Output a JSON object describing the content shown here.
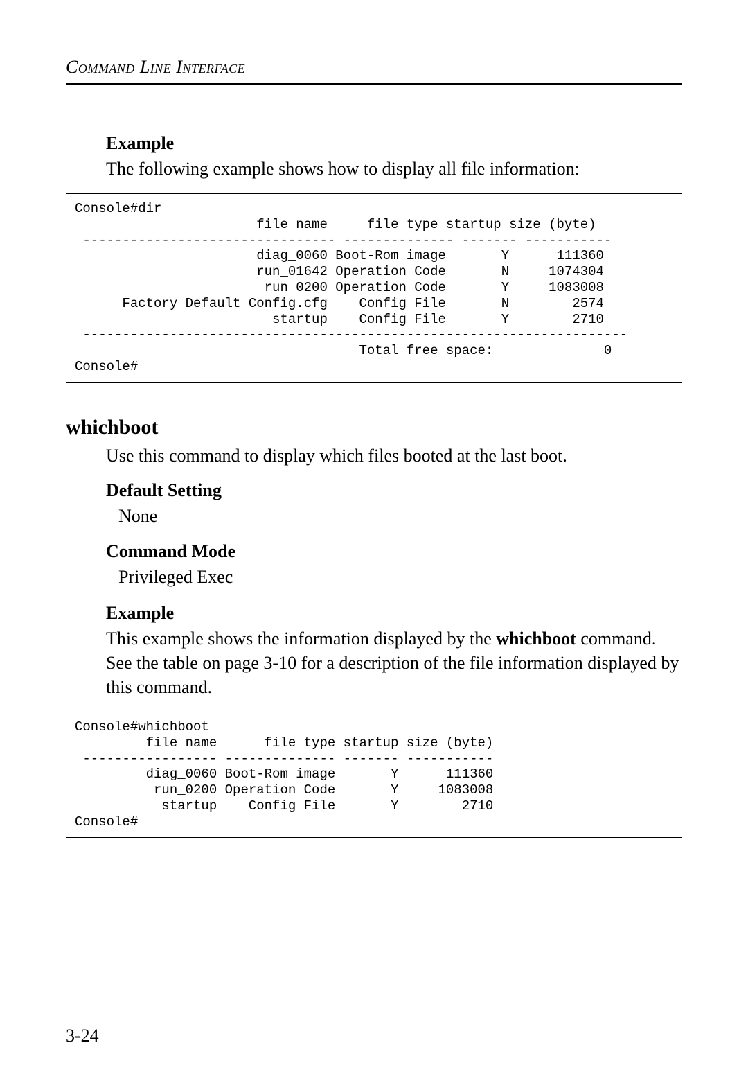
{
  "header": "Command Line Interface",
  "example1": {
    "heading": "Example",
    "text": "The following example shows how to display all file information:"
  },
  "code1": "Console#dir\n                       file name     file type startup size (byte)\n -------------------------------- -------------- ------- -----------\n                       diag_0060 Boot-Rom image       Y      111360\n                       run_01642 Operation Code       N     1074304\n                        run_0200 Operation Code       Y     1083008\n      Factory_Default_Config.cfg    Config File       N        2574\n                         startup    Config File       Y        2710\n ---------------------------------------------------------------------\n                                    Total free space:              0\nConsole#",
  "whichboot": {
    "title": "whichboot",
    "desc": "Use this command to display which files booted at the last boot.",
    "default_heading": "Default Setting",
    "default_value": "None",
    "mode_heading": "Command Mode",
    "mode_value": "Privileged Exec",
    "example_heading": "Example",
    "example_text_pre": "This example shows the information displayed by the ",
    "example_cmd": "whichboot",
    "example_text_post": " command. See the table on page 3-10 for a description of the file information displayed by this command."
  },
  "code2": "Console#whichboot\n         file name      file type startup size (byte)\n ----------------- -------------- ------- -----------\n         diag_0060 Boot-Rom image       Y      111360\n          run_0200 Operation Code       Y     1083008\n           startup    Config File       Y        2710\nConsole#",
  "footer": "3-24"
}
